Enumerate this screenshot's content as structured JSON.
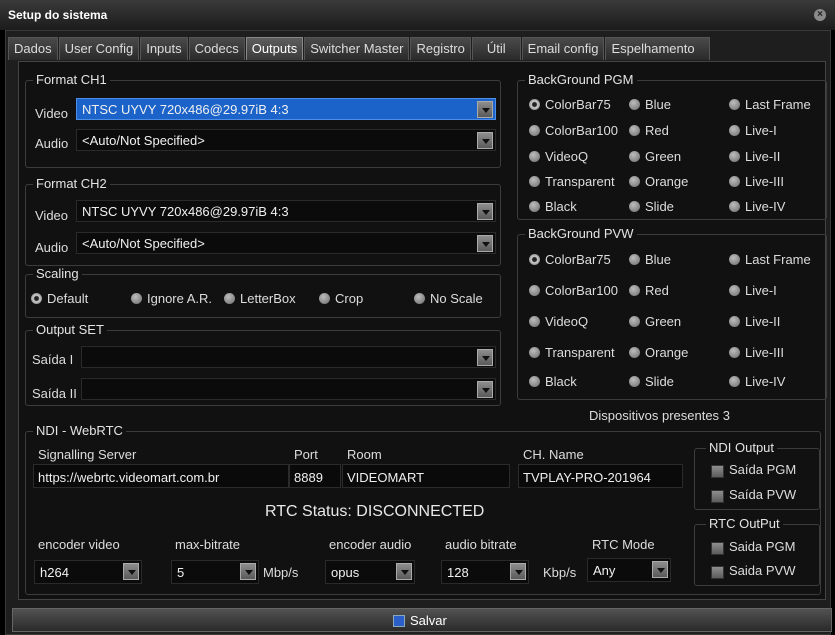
{
  "window": {
    "title": "Setup do sistema"
  },
  "tabs": [
    "Dados",
    "User Config",
    "Inputs",
    "Codecs",
    "Outputs",
    "Switcher Master",
    "Registro",
    "Útil",
    "Email config",
    "Espelhamento"
  ],
  "format_ch1": {
    "title": "Format CH1",
    "video_label": "Video",
    "video_value": "NTSC UYVY 720x486@29.97iB 4:3",
    "audio_label": "Audio",
    "audio_value": "<Auto/Not Specified>"
  },
  "format_ch2": {
    "title": "Format CH2",
    "video_label": "Video",
    "video_value": "NTSC UYVY 720x486@29.97iB 4:3",
    "audio_label": "Audio",
    "audio_value": "<Auto/Not Specified>"
  },
  "scaling": {
    "title": "Scaling",
    "options": [
      "Default",
      "Ignore A.R.",
      "LetterBox",
      "Crop",
      "No Scale"
    ],
    "selected": "Default"
  },
  "output_set": {
    "title": "Output SET",
    "saida1_label": "Saída I",
    "saida2_label": "Saída II",
    "saida1_value": "",
    "saida2_value": ""
  },
  "bg_pgm": {
    "title": "BackGround PGM",
    "options": [
      "ColorBar75",
      "Blue",
      "Last Frame",
      "ColorBar100",
      "Red",
      "Live-I",
      "VideoQ",
      "Green",
      "Live-II",
      "Transparent",
      "Orange",
      "Live-III",
      "Black",
      "Slide",
      "Live-IV"
    ],
    "selected": "ColorBar75"
  },
  "bg_pvw": {
    "title": "BackGround PVW",
    "options": [
      "ColorBar75",
      "Blue",
      "Last Frame",
      "ColorBar100",
      "Red",
      "Live-I",
      "VideoQ",
      "Green",
      "Live-II",
      "Transparent",
      "Orange",
      "Live-III",
      "Black",
      "Slide",
      "Live-IV"
    ],
    "selected": "ColorBar75"
  },
  "devices": {
    "label": "Dispositivos presentes",
    "count": "3"
  },
  "ndi": {
    "title": "NDI - WebRTC",
    "signalling_label": "Signalling Server",
    "signalling_value": "https://webrtc.videomart.com.br",
    "port_label": "Port",
    "port_value": "8889",
    "room_label": "Room",
    "room_value": "VIDEOMART",
    "chname_label": "CH. Name",
    "chname_value": "TVPLAY-PRO-201964",
    "rtc_status": "RTC Status: DISCONNECTED",
    "encoder_video_label": "encoder video",
    "encoder_video_value": "h264",
    "max_bitrate_label": "max-bitrate",
    "max_bitrate_value": "5",
    "mbps": "Mbp/s",
    "encoder_audio_label": "encoder audio",
    "encoder_audio_value": "opus",
    "audio_bitrate_label": "audio bitrate",
    "audio_bitrate_value": "128",
    "kbps": "Kbp/s",
    "rtc_mode_label": "RTC Mode",
    "rtc_mode_value": "Any"
  },
  "ndi_output": {
    "title": "NDI Output",
    "pgm": "Saída PGM",
    "pvw": "Saída PVW"
  },
  "rtc_output": {
    "title": "RTC OutPut",
    "pgm": "Saida PGM",
    "pvw": "Saida PVW"
  },
  "save_label": "Salvar"
}
